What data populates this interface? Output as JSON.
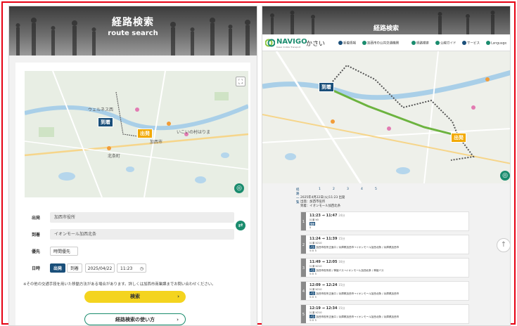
{
  "left": {
    "hero_title": "経路検索",
    "hero_subtitle": "route search",
    "map_pins": {
      "departure": "到着",
      "arrival": "出発"
    },
    "map_labels": [
      "加西市",
      "いこいの村はりま",
      "北条町",
      "ウェルネス西"
    ],
    "form": {
      "departure_label": "出発",
      "departure_value": "加西市役所",
      "arrival_label": "到着",
      "arrival_value": "イオンモール加西北条",
      "priority_label": "優先",
      "priority_value": "時間優先",
      "datetime_label": "日時",
      "mode_departure": "出発",
      "mode_arrival": "到着",
      "date": "2025/04/22",
      "time": "11:23"
    },
    "note": "※その他の交通手段を用いた移動方法がある場合があります。詳しくは加西市商業課までお問い合わせください。",
    "search_button": "検索",
    "howto_button": "経路検索の使い方",
    "arrow": "›"
  },
  "right": {
    "hero_title": "経路検索",
    "logo_text": "NAVIGO",
    "logo_city": "かさい",
    "logo_sub": "Kasai mobile Transport",
    "nav": [
      {
        "label": "新着情報",
        "color": "#1a4f7a"
      },
      {
        "label": "加西市の公共交通機関",
        "color": "#1a8c6e"
      },
      {
        "label": "経路検索",
        "color": "#1a8c6e"
      },
      {
        "label": "公線ガイド",
        "color": "#1a8c6e"
      },
      {
        "label": "サービス",
        "color": "#1a4f7a"
      },
      {
        "label": "Language",
        "color": "#1a8c6e"
      }
    ],
    "map_pins": {
      "departure": "到着",
      "arrival": "出発"
    },
    "paging": [
      "経路一覧",
      "1",
      "2",
      "3",
      "4",
      "5"
    ],
    "info": [
      "2025年4月22日(火)11:23 出発",
      "出発：加西市役所",
      "到着：イオンモール加西北条"
    ],
    "routes": [
      {
        "num": "1",
        "time": "11:23 → 11:47",
        "mins": "24分",
        "fare": "片道 ¥0",
        "line": "",
        "icons": "5"
      },
      {
        "num": "2",
        "time": "11:24 → 11:39",
        "mins": "15分",
        "fare": "片道 ¥210",
        "line": "加西市役所正面口 / 兵庫県加西市→イオンモール加西北条 / 兵庫県加西市",
        "icons": "5 ⊟ 5"
      },
      {
        "num": "3",
        "time": "11:49 → 12:05",
        "mins": "16分",
        "fare": "片道 ¥210",
        "line": "加西市役所前 / 神姫バス→イオンモール加西北条 / 神姫バス",
        "icons": "5 ⊟ 5"
      },
      {
        "num": "4",
        "time": "12:09 → 12:24",
        "mins": "15分",
        "fare": "片道 ¥210",
        "line": "加西市役所正面口 / 兵庫県加西市→イオンモール加西北条 / 兵庫県加西市",
        "icons": "5 ⊟ 5"
      },
      {
        "num": "5",
        "time": "12:19 → 12:34",
        "mins": "15分",
        "fare": "片道 ¥210",
        "line": "加西市役所正面口 / 兵庫県加西市→イオンモール加西北条 / 兵庫県加西市",
        "icons": "5 ⊟ 5"
      }
    ]
  },
  "colors": {
    "frame": "#e60012",
    "accent_green": "#1a8c6e",
    "accent_navy": "#1a4f7a",
    "search_yellow": "#f4d41f"
  }
}
